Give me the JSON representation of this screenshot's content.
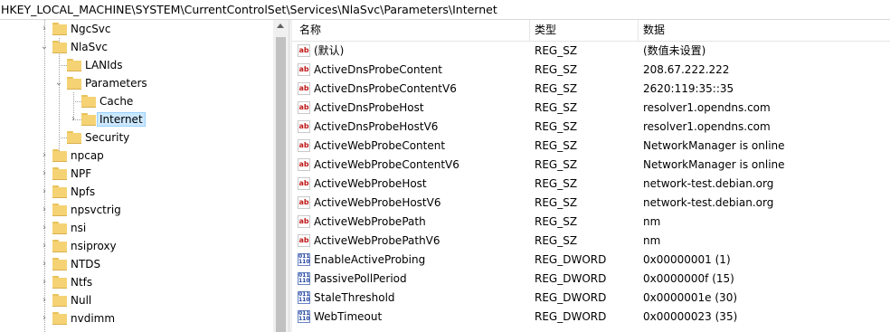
{
  "address_path": "HKEY_LOCAL_MACHINE\\SYSTEM\\CurrentControlSet\\Services\\NlaSvc\\Parameters\\Internet",
  "tree": {
    "ngcsvc": "NgcSvc",
    "nlasvc": "NlaSvc",
    "lanids": "LANIds",
    "parameters": "Parameters",
    "cache": "Cache",
    "internet": "Internet",
    "security": "Security",
    "npcap": "npcap",
    "npf": "NPF",
    "npfs": "Npfs",
    "npsvctrig": "npsvctrig",
    "nsi": "nsi",
    "nsiproxy": "nsiproxy",
    "ntds": "NTDS",
    "ntfs": "Ntfs",
    "null": "Null",
    "nvdimm": "nvdimm"
  },
  "columns": {
    "name": "名称",
    "type": "类型",
    "data": "数据"
  },
  "values": [
    {
      "icon": "string-value-icon",
      "name": "(默认)",
      "type": "REG_SZ",
      "data": "(数值未设置)"
    },
    {
      "icon": "string-value-icon",
      "name": "ActiveDnsProbeContent",
      "type": "REG_SZ",
      "data": "208.67.222.222"
    },
    {
      "icon": "string-value-icon",
      "name": "ActiveDnsProbeContentV6",
      "type": "REG_SZ",
      "data": "2620:119:35::35"
    },
    {
      "icon": "string-value-icon",
      "name": "ActiveDnsProbeHost",
      "type": "REG_SZ",
      "data": "resolver1.opendns.com"
    },
    {
      "icon": "string-value-icon",
      "name": "ActiveDnsProbeHostV6",
      "type": "REG_SZ",
      "data": "resolver1.opendns.com"
    },
    {
      "icon": "string-value-icon",
      "name": "ActiveWebProbeContent",
      "type": "REG_SZ",
      "data": "NetworkManager is online"
    },
    {
      "icon": "string-value-icon",
      "name": "ActiveWebProbeContentV6",
      "type": "REG_SZ",
      "data": "NetworkManager is online"
    },
    {
      "icon": "string-value-icon",
      "name": "ActiveWebProbeHost",
      "type": "REG_SZ",
      "data": "network-test.debian.org"
    },
    {
      "icon": "string-value-icon",
      "name": "ActiveWebProbeHostV6",
      "type": "REG_SZ",
      "data": "network-test.debian.org"
    },
    {
      "icon": "string-value-icon",
      "name": "ActiveWebProbePath",
      "type": "REG_SZ",
      "data": "nm"
    },
    {
      "icon": "string-value-icon",
      "name": "ActiveWebProbePathV6",
      "type": "REG_SZ",
      "data": "nm"
    },
    {
      "icon": "dword-value-icon",
      "name": "EnableActiveProbing",
      "type": "REG_DWORD",
      "data": "0x00000001 (1)"
    },
    {
      "icon": "dword-value-icon",
      "name": "PassivePollPeriod",
      "type": "REG_DWORD",
      "data": "0x0000000f (15)"
    },
    {
      "icon": "dword-value-icon",
      "name": "StaleThreshold",
      "type": "REG_DWORD",
      "data": "0x0000001e (30)"
    },
    {
      "icon": "dword-value-icon",
      "name": "WebTimeout",
      "type": "REG_DWORD",
      "data": "0x00000023 (35)"
    }
  ],
  "icons": {
    "sz_glyph": "ab",
    "dword_glyph": "011\n110"
  }
}
